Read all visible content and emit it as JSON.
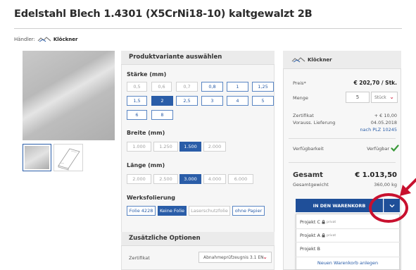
{
  "product": {
    "title": "Edelstahl Blech 1.4301 (X5CrNi18-10) kaltgewalzt 2B",
    "dealer_label": "Händler:",
    "dealer_name": "Klöckner"
  },
  "variant": {
    "title": "Produktvariante auswählen",
    "thickness": {
      "label": "Stärke (mm)",
      "options": [
        {
          "label": "0,5",
          "state": "disabled"
        },
        {
          "label": "0,6",
          "state": "disabled"
        },
        {
          "label": "0,7",
          "state": "disabled"
        },
        {
          "label": "0,8",
          "state": "available"
        },
        {
          "label": "1",
          "state": "available"
        },
        {
          "label": "1,25",
          "state": "available"
        },
        {
          "label": "1,5",
          "state": "available"
        },
        {
          "label": "2",
          "state": "selected"
        },
        {
          "label": "2,5",
          "state": "available"
        },
        {
          "label": "3",
          "state": "available"
        },
        {
          "label": "4",
          "state": "available"
        },
        {
          "label": "5",
          "state": "available"
        },
        {
          "label": "6",
          "state": "available"
        },
        {
          "label": "8",
          "state": "available"
        }
      ]
    },
    "width": {
      "label": "Breite (mm)",
      "options": [
        {
          "label": "1.000",
          "state": "disabled"
        },
        {
          "label": "1.250",
          "state": "disabled"
        },
        {
          "label": "1.500",
          "state": "selected"
        },
        {
          "label": "2.000",
          "state": "disabled"
        }
      ]
    },
    "length": {
      "label": "Länge (mm)",
      "options": [
        {
          "label": "2.000",
          "state": "disabled"
        },
        {
          "label": "2.500",
          "state": "disabled"
        },
        {
          "label": "3.000",
          "state": "selected"
        },
        {
          "label": "4.000",
          "state": "disabled"
        },
        {
          "label": "6.000",
          "state": "disabled"
        }
      ]
    },
    "foil": {
      "label": "Werksfolierung",
      "options": [
        {
          "label": "Folie 4228",
          "state": "available"
        },
        {
          "label": "Keine Folie",
          "state": "selected"
        },
        {
          "label": "Laserschutzfolie",
          "state": "disabled"
        },
        {
          "label": "ohne Papier",
          "state": "available"
        }
      ]
    }
  },
  "extras": {
    "title": "Zusätzliche Optionen",
    "certificate_label": "Zertifikat",
    "certificate_value": "Abnahmeprüfzeugnis 3.1 EN"
  },
  "order": {
    "dealer_name": "Klöckner",
    "price_label": "Preis*",
    "price_value": "€ 202,70 / Stk.",
    "quantity_label": "Menge",
    "quantity_value": "5",
    "unit_value": "Stück",
    "certificate_label": "Zertifikat",
    "certificate_price": "+ € 10,00",
    "delivery_label": "Vorauss. Lieferung",
    "delivery_date": "04.05.2018",
    "delivery_link": "nach PLZ 10245",
    "availability_label": "Verfügbarkeit",
    "availability_value": "Verfügbar",
    "total_label": "Gesamt",
    "total_value": "€ 1.013,50",
    "weight_label": "Gesamtgewicht",
    "weight_value": "360,00 kg",
    "cart_button": "IN DEN WARENKORB",
    "projects": [
      {
        "label": "Projekt C",
        "badge": "privat"
      },
      {
        "label": "Projekt A",
        "badge": "privat"
      },
      {
        "label": "Projekt B",
        "badge": ""
      }
    ],
    "new_cart": "Neuen Warenkorb anlegen"
  },
  "colors": {
    "accent_blue": "#2a5da8",
    "cart_blue": "#1f4f99",
    "highlight_red": "#c8102e",
    "available_green": "#3a9a3a"
  }
}
